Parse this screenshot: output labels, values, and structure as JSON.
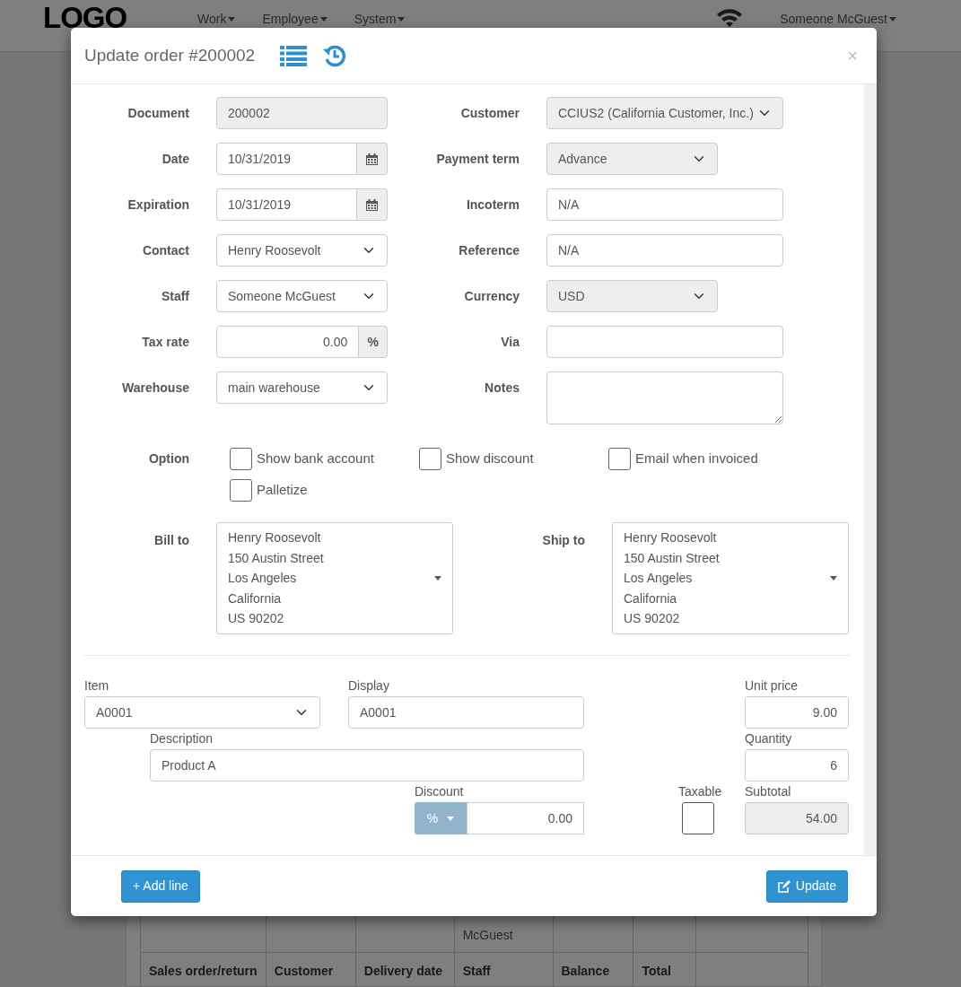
{
  "navbar": {
    "logo": "LOGO",
    "menus": [
      "Work",
      "Employee",
      "System"
    ],
    "user": "Someone McGuest"
  },
  "background_table": {
    "visible_cell": "McGuest",
    "columns": [
      "Sales order/return",
      "Customer",
      "Delivery date",
      "Staff",
      "Balance",
      "Total"
    ]
  },
  "modal": {
    "title": "Update order #200002",
    "close": "×",
    "left_fields": [
      {
        "label": "Document",
        "kind": "readonly",
        "value": "200002"
      },
      {
        "label": "Date",
        "kind": "date",
        "value": "10/31/2019"
      },
      {
        "label": "Expiration",
        "kind": "date",
        "value": "10/31/2019"
      },
      {
        "label": "Contact",
        "kind": "select",
        "value": "Henry Roosevolt"
      },
      {
        "label": "Staff",
        "kind": "select",
        "value": "Someone McGuest"
      },
      {
        "label": "Tax rate",
        "kind": "percent",
        "value": "0.00",
        "addon": "%"
      },
      {
        "label": "Warehouse",
        "kind": "select",
        "value": "main warehouse"
      }
    ],
    "right_fields": [
      {
        "label": "Customer",
        "kind": "locked_select",
        "value": "CCIUS2 (California Customer, Inc.)"
      },
      {
        "label": "Payment term",
        "kind": "locked_select_short",
        "value": "Advance"
      },
      {
        "label": "Incoterm",
        "kind": "input",
        "value": "N/A"
      },
      {
        "label": "Reference",
        "kind": "input",
        "value": "N/A"
      },
      {
        "label": "Currency",
        "kind": "locked_select_short",
        "value": "USD"
      },
      {
        "label": "Via",
        "kind": "input"
      },
      {
        "label": "Notes",
        "kind": "textarea"
      }
    ],
    "options": {
      "label": "Option",
      "items": [
        {
          "label": "Show bank account",
          "checked": false
        },
        {
          "label": "Show discount",
          "checked": false
        },
        {
          "label": "Email when invoiced",
          "checked": false
        },
        {
          "label": "Palletize",
          "checked": false
        }
      ]
    },
    "bill_to": {
      "label": "Bill to",
      "lines": [
        "Henry Roosevolt",
        "150 Austin Street",
        "Los Angeles",
        "California",
        "US 90202"
      ]
    },
    "ship_to": {
      "label": "Ship to",
      "lines": [
        "Henry Roosevolt",
        "150 Austin Street",
        "Los Angeles",
        "California",
        "US 90202"
      ]
    },
    "line_item": {
      "item": {
        "label": "Item",
        "value": "A0001"
      },
      "display": {
        "label": "Display",
        "value": "A0001"
      },
      "unit_price": {
        "label": "Unit price",
        "value": "9.00"
      },
      "description": {
        "label": "Description",
        "value": "Product A"
      },
      "quantity": {
        "label": "Quantity",
        "value": "6"
      },
      "discount": {
        "label": "Discount",
        "type": "%",
        "value": "0.00"
      },
      "taxable": {
        "label": "Taxable",
        "checked": false
      },
      "subtotal": {
        "label": "Subtotal",
        "value": "54.00"
      }
    },
    "buttons": {
      "add_line": "+ Add line",
      "update": "Update"
    }
  }
}
